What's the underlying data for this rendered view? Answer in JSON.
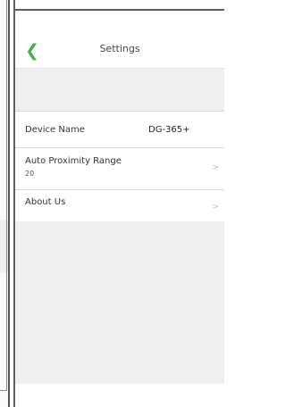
{
  "header": {
    "title": "Settings",
    "back_icon": "chevron-left-icon",
    "accent_color": "#4caf50"
  },
  "settings": {
    "items": [
      {
        "label": "Device Name",
        "value": "DG-365+"
      },
      {
        "label": "Auto Proximity Range",
        "value": "20",
        "chevron": ">"
      },
      {
        "label": "About Us",
        "chevron": ">"
      }
    ]
  }
}
